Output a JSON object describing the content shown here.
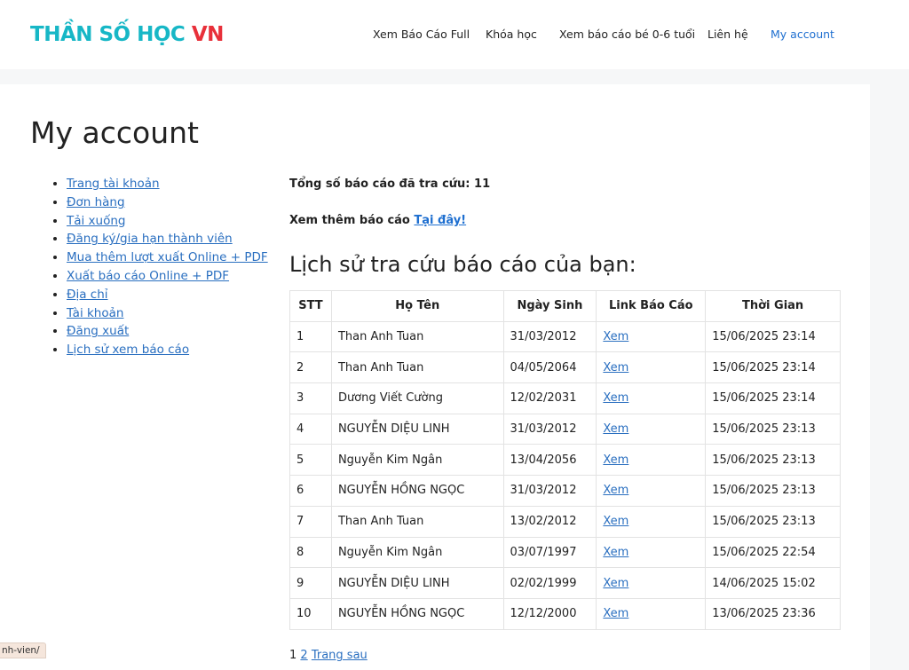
{
  "header": {
    "logo_part1": "THẦN SỐ HỌC",
    "logo_part2": "VN",
    "nav": [
      {
        "label": "Xem Báo Cáo Full"
      },
      {
        "label": "Khóa học"
      },
      {
        "label": "Xem báo cáo bé 0-6 tuổi"
      },
      {
        "label": "Liên hệ"
      },
      {
        "label": "My account",
        "active": true
      }
    ],
    "accent_color": "#1e6fd0"
  },
  "page": {
    "title": "My account"
  },
  "account_menu": [
    {
      "label": "Trang tài khoản"
    },
    {
      "label": "Đơn hàng"
    },
    {
      "label": "Tải xuống"
    },
    {
      "label": "Đăng ký/gia hạn thành viên"
    },
    {
      "label": "Mua thêm lượt xuất Online + PDF"
    },
    {
      "label": "Xuất báo cáo Online + PDF"
    },
    {
      "label": "Địa chỉ"
    },
    {
      "label": "Tài khoản"
    },
    {
      "label": "Đăng xuất"
    },
    {
      "label": "Lịch sử xem báo cáo"
    }
  ],
  "summary": {
    "label": "Tổng số báo cáo đã tra cứu:",
    "count": "11"
  },
  "more": {
    "text": "Xem thêm báo cáo",
    "link": "Tại đây!"
  },
  "history": {
    "title": "Lịch sử tra cứu báo cáo của bạn:",
    "columns": [
      "STT",
      "Họ Tên",
      "Ngày Sinh",
      "Link Báo Cáo",
      "Thời Gian"
    ],
    "rows": [
      {
        "stt": "1",
        "name": "Than Anh Tuan",
        "dob": "31/03/2012",
        "link": "Xem",
        "time": "15/06/2025 23:14"
      },
      {
        "stt": "2",
        "name": "Than Anh Tuan",
        "dob": "04/05/2064",
        "link": "Xem",
        "time": "15/06/2025 23:14"
      },
      {
        "stt": "3",
        "name": "Dương Viết Cường",
        "dob": "12/02/2031",
        "link": "Xem",
        "time": "15/06/2025 23:14"
      },
      {
        "stt": "4",
        "name": "NGUYỄN DIỆU LINH",
        "dob": "31/03/2012",
        "link": "Xem",
        "time": "15/06/2025 23:13"
      },
      {
        "stt": "5",
        "name": "Nguyễn Kim Ngân",
        "dob": "13/04/2056",
        "link": "Xem",
        "time": "15/06/2025 23:13"
      },
      {
        "stt": "6",
        "name": "NGUYỄN HỒNG NGỌC",
        "dob": "31/03/2012",
        "link": "Xem",
        "time": "15/06/2025 23:13"
      },
      {
        "stt": "7",
        "name": "Than Anh Tuan",
        "dob": "13/02/2012",
        "link": "Xem",
        "time": "15/06/2025 23:13"
      },
      {
        "stt": "8",
        "name": "Nguyễn Kim Ngân",
        "dob": "03/07/1997",
        "link": "Xem",
        "time": "15/06/2025 22:54"
      },
      {
        "stt": "9",
        "name": "NGUYỄN DIỆU LINH",
        "dob": "02/02/1999",
        "link": "Xem",
        "time": "14/06/2025 15:02"
      },
      {
        "stt": "10",
        "name": "NGUYỄN HỒNG NGỌC",
        "dob": "12/12/2000",
        "link": "Xem",
        "time": "13/06/2025 23:36"
      }
    ]
  },
  "pagination": {
    "current": "1",
    "next_page": "2",
    "next_label": "Trang sau"
  },
  "status_bar": {
    "url": "nh-vien/"
  }
}
